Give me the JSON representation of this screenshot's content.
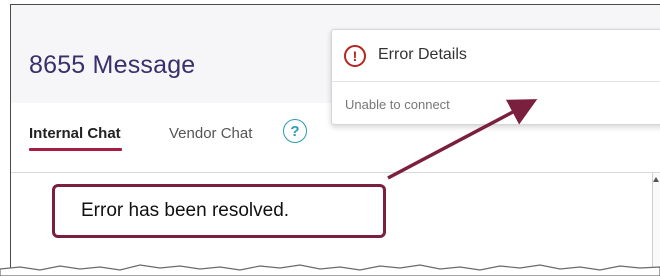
{
  "app": {
    "title": "8655 Message"
  },
  "tabs": [
    {
      "label": "Internal Chat",
      "active": true
    },
    {
      "label": "Vendor Chat",
      "active": false
    }
  ],
  "help_icon": {
    "glyph": "?"
  },
  "toast": {
    "icon": "error-circle-icon",
    "icon_glyph": "!",
    "title": "Error Details",
    "close_glyph": "×",
    "message": "Unable to connect"
  },
  "callout": {
    "text": "Error has been resolved."
  },
  "colors": {
    "brand_purple": "#3a2f6b",
    "active_tab_underline": "#a51c45",
    "error_red": "#b3261e",
    "help_teal": "#2b9bb0",
    "callout_border": "#7a1f3d"
  }
}
